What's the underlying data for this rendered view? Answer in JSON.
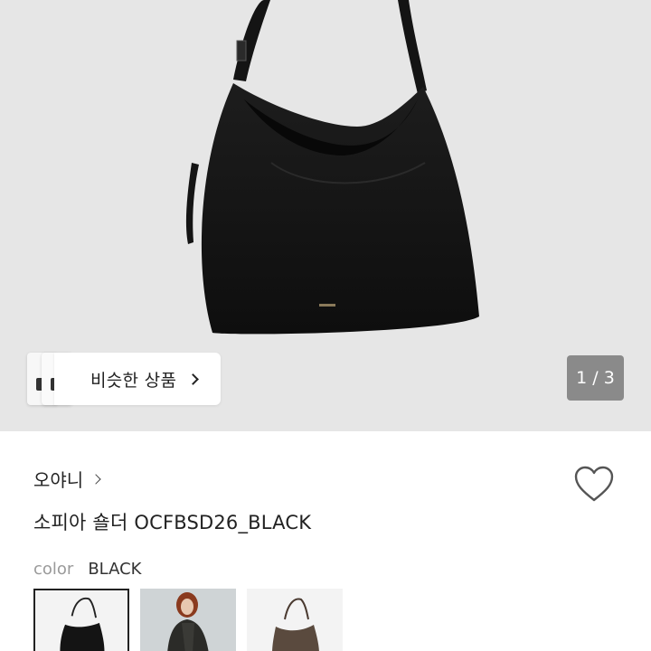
{
  "gallery": {
    "similar_label": "비슷한 상품",
    "page_counter": "1 / 3",
    "main_image_icon": "shoulder-bag-image"
  },
  "product": {
    "brand": "오야니",
    "title": "소피아 숄더 OCFBSD26_BLACK",
    "color_key": "color",
    "color_value": "BLACK"
  },
  "swatches": [
    {
      "icon": "black-bag-thumbnail",
      "selected": true
    },
    {
      "icon": "model-photo-thumbnail",
      "selected": false
    },
    {
      "icon": "brown-bag-thumbnail",
      "selected": false
    }
  ],
  "colors": {
    "hero_bg": "#e6e6e6",
    "bag": "#161616",
    "counter_bg": "#8a8a8a"
  }
}
